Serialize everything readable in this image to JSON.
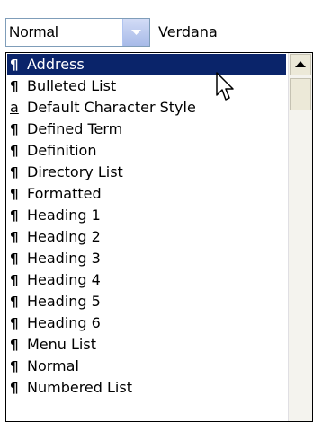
{
  "toolbar": {
    "style_value": "Normal",
    "font_value": "Verdana"
  },
  "style_list": {
    "items": [
      {
        "glyph": "¶",
        "label": "Address",
        "selected": true
      },
      {
        "glyph": "¶",
        "label": "Bulleted List"
      },
      {
        "glyph": "a",
        "label": "Default Character Style"
      },
      {
        "glyph": "¶",
        "label": "Defined Term"
      },
      {
        "glyph": "¶",
        "label": "Definition"
      },
      {
        "glyph": "¶",
        "label": "Directory List"
      },
      {
        "glyph": "¶",
        "label": "Formatted"
      },
      {
        "glyph": "¶",
        "label": "Heading 1"
      },
      {
        "glyph": "¶",
        "label": "Heading 2"
      },
      {
        "glyph": "¶",
        "label": "Heading 3"
      },
      {
        "glyph": "¶",
        "label": "Heading 4"
      },
      {
        "glyph": "¶",
        "label": "Heading 5"
      },
      {
        "glyph": "¶",
        "label": "Heading 6"
      },
      {
        "glyph": "¶",
        "label": "Menu List"
      },
      {
        "glyph": "¶",
        "label": "Normal"
      },
      {
        "glyph": "¶",
        "label": "Numbered List"
      }
    ]
  },
  "colors": {
    "selection": "#0a246a",
    "combo_arrow": "#a7bae8"
  },
  "icons": {
    "paragraph_style": "pilcrow-icon",
    "character_style": "underlined-a-icon",
    "dropdown_arrow": "chevron-down-icon",
    "scroll_up": "arrow-up-icon",
    "cursor": "mouse-pointer-icon"
  }
}
